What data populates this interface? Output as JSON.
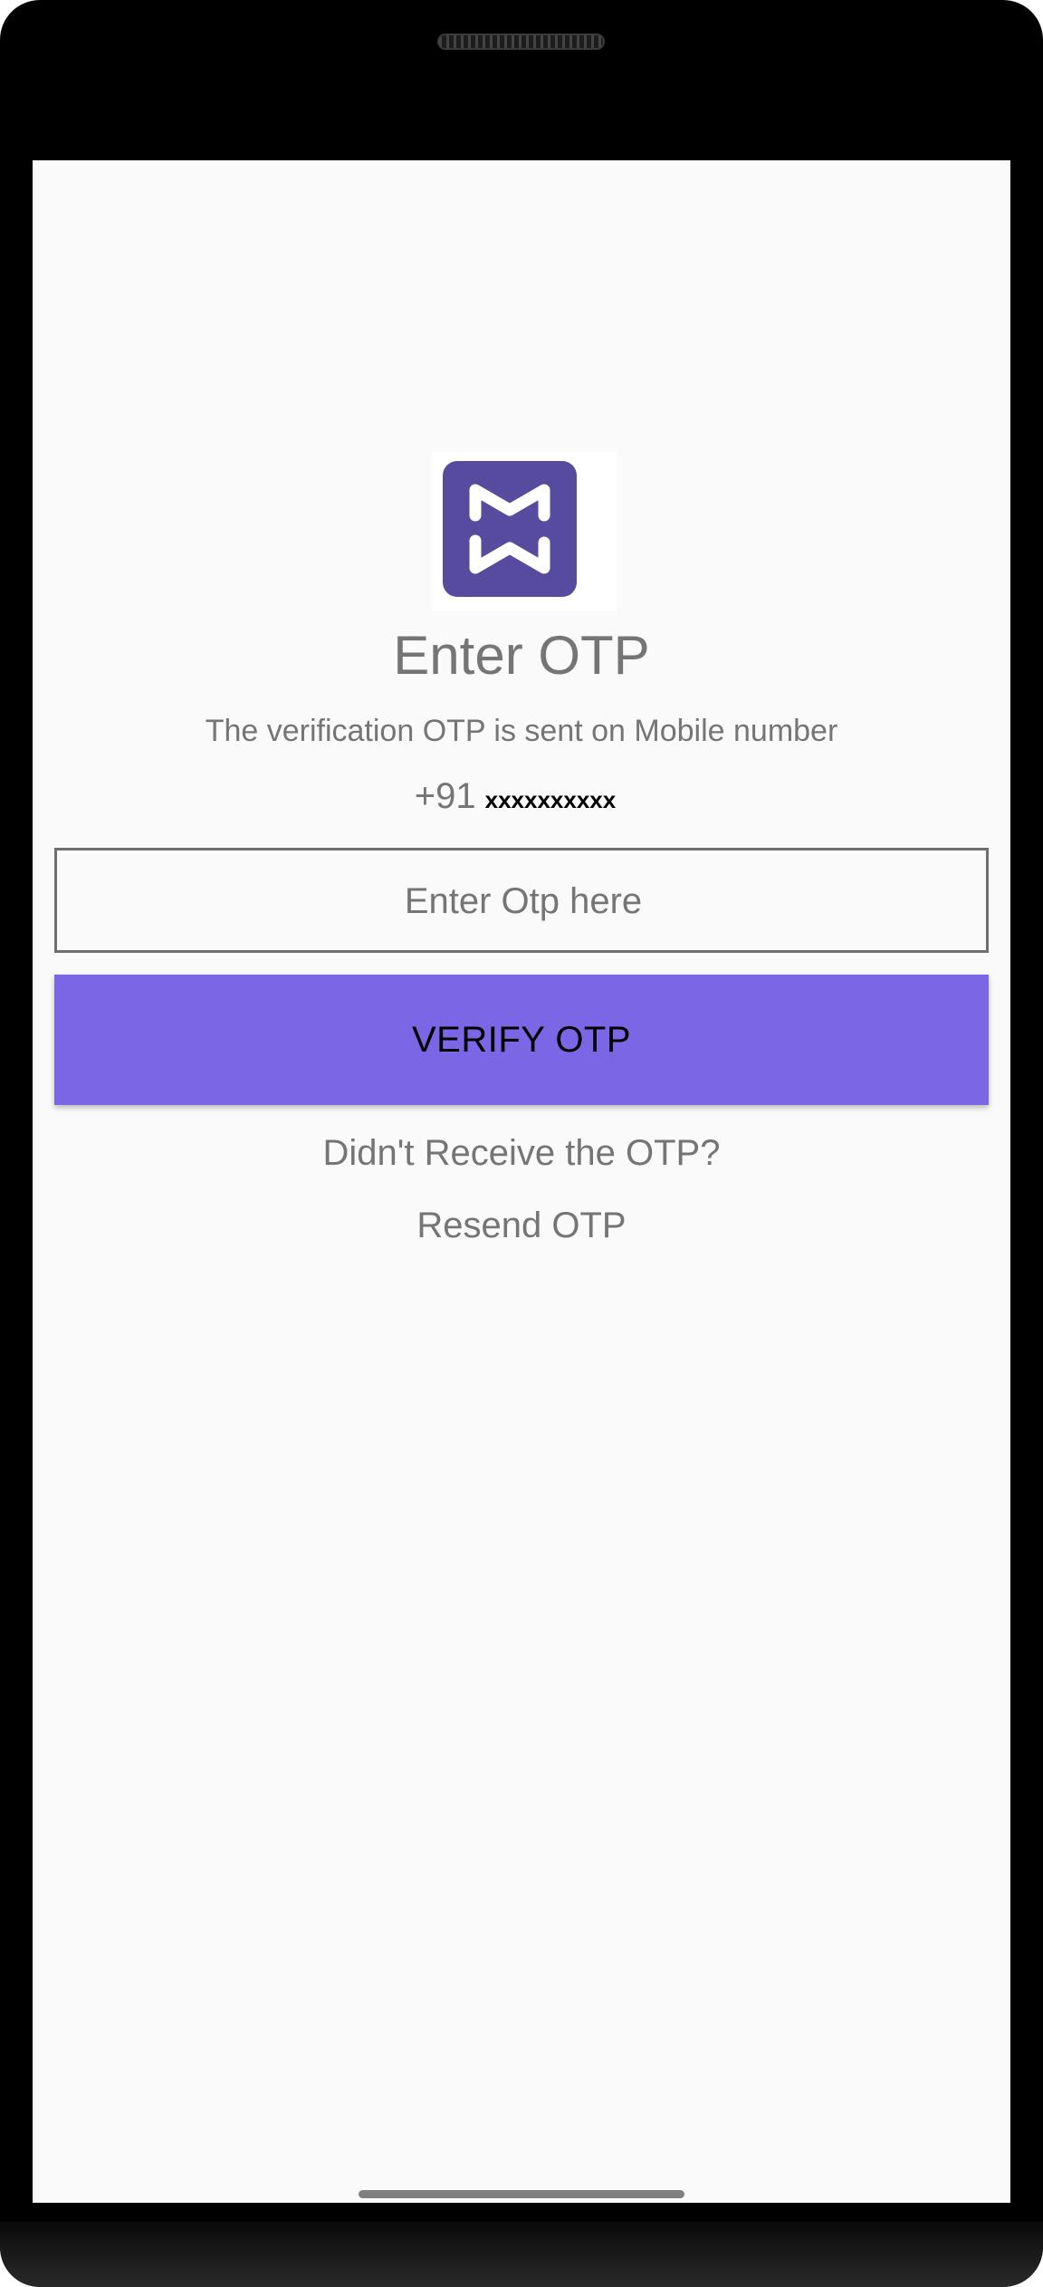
{
  "brand": {
    "logo_icon": "mn-logo-icon",
    "logo_color": "#564b9e"
  },
  "otp_screen": {
    "title": "Enter OTP",
    "subtitle": "The verification OTP is sent on Mobile number",
    "country_code": "+91",
    "phone_number": "xxxxxxxxxx",
    "otp_input": {
      "value": "",
      "placeholder": "Enter Otp here"
    },
    "verify_button_label": "VERIFY OTP",
    "verify_button_color": "#7b66e6",
    "not_received_text": "Didn't Receive the OTP?",
    "resend_label": "Resend OTP"
  }
}
